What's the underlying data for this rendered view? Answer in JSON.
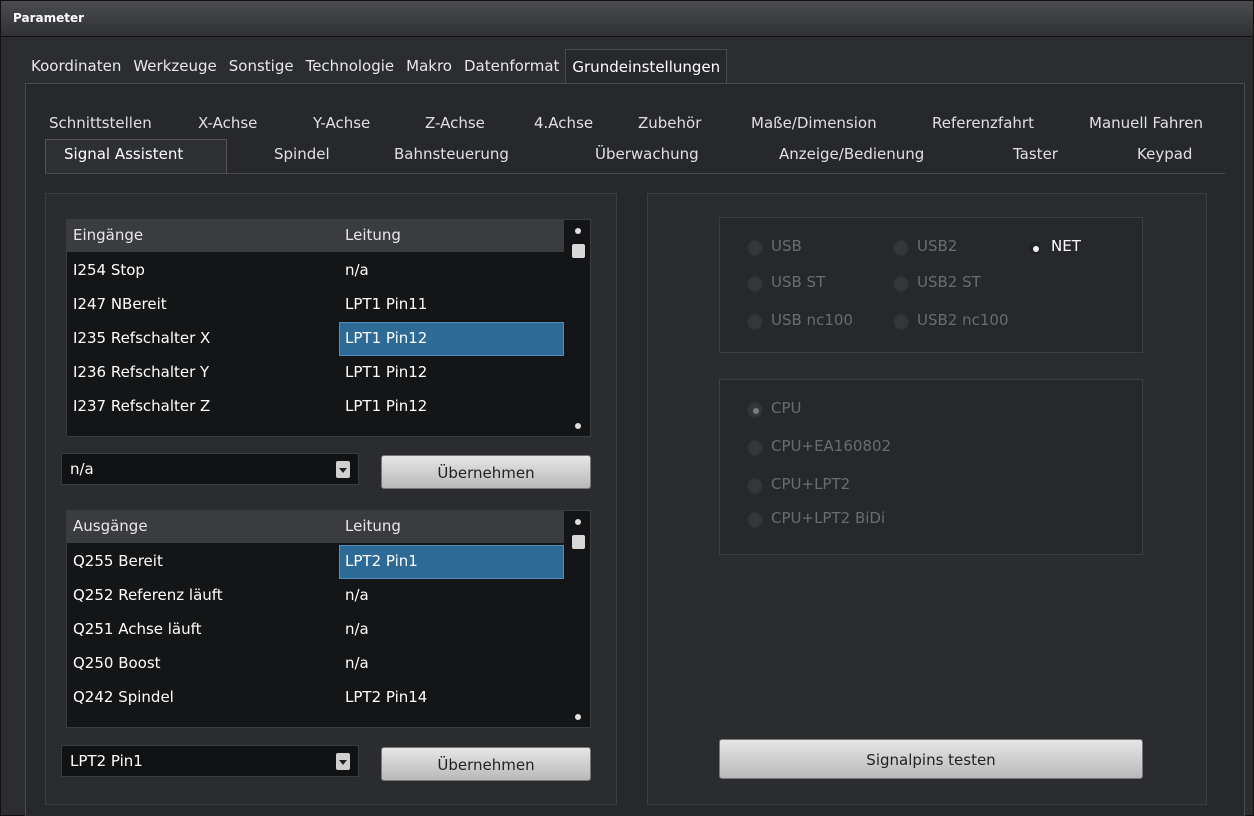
{
  "window": {
    "title": "Parameter"
  },
  "main_tabs": [
    "Koordinaten",
    "Werkzeuge",
    "Sonstige",
    "Technologie",
    "Makro",
    "Datenformat",
    "Grundeinstellungen"
  ],
  "main_tab_active": "Grundeinstellungen",
  "sub_tabs_row1": [
    "Schnittstellen",
    "X-Achse",
    "Y-Achse",
    "Z-Achse",
    "4.Achse",
    "Zubehör",
    "Maße/Dimension",
    "Referenzfahrt",
    "Manuell Fahren"
  ],
  "sub_tabs_row2": [
    "Signal Assistent",
    "Spindel",
    "Bahnsteuerung",
    "Überwachung",
    "Anzeige/Bedienung",
    "Taster",
    "Keypad"
  ],
  "sub_tab_active": "Signal Assistent",
  "inputs": {
    "headers": {
      "name": "Eingänge",
      "line": "Leitung"
    },
    "rows": [
      {
        "name": "I254 Stop",
        "line": "n/a"
      },
      {
        "name": "I247 NBereit",
        "line": "LPT1 Pin11"
      },
      {
        "name": "I235 Refschalter X",
        "line": "LPT1 Pin12",
        "selected": true
      },
      {
        "name": "I236 Refschalter Y",
        "line": "LPT1 Pin12"
      },
      {
        "name": "I237 Refschalter Z",
        "line": "LPT1 Pin12"
      }
    ],
    "combo_value": "n/a",
    "apply_label": "Übernehmen"
  },
  "outputs": {
    "headers": {
      "name": "Ausgänge",
      "line": "Leitung"
    },
    "rows": [
      {
        "name": "Q255 Bereit",
        "line": "LPT2 Pin1",
        "selected": true
      },
      {
        "name": "Q252 Referenz läuft",
        "line": "n/a"
      },
      {
        "name": "Q251 Achse läuft",
        "line": "n/a"
      },
      {
        "name": "Q250 Boost",
        "line": "n/a"
      },
      {
        "name": "Q242 Spindel",
        "line": "LPT2 Pin14"
      }
    ],
    "combo_value": "LPT2 Pin1",
    "apply_label": "Übernehmen"
  },
  "interface_options": {
    "usb": "USB",
    "usb2": "USB2",
    "net": "NET",
    "usb_st": "USB ST",
    "usb2_st": "USB2 ST",
    "usb_nc100": "USB nc100",
    "usb2_nc100": "USB2 nc100",
    "selected": "NET"
  },
  "cpu_options": {
    "cpu": "CPU",
    "cpu_ea": "CPU+EA160802",
    "cpu_lpt2": "CPU+LPT2",
    "cpu_lpt2_bidi": "CPU+LPT2 BiDi",
    "selected": "CPU"
  },
  "test_button_label": "Signalpins testen"
}
